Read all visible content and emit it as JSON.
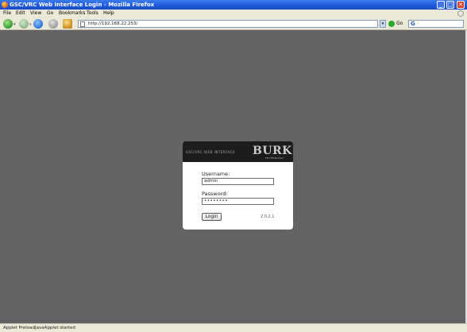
{
  "window": {
    "title": "GSC/VRC Web Interface Login - Mozilla Firefox",
    "controls": {
      "minimize": "_",
      "maximize": "□",
      "close": "✕"
    }
  },
  "menu": [
    "File",
    "Edit",
    "View",
    "Go",
    "Bookmarks",
    "Tools",
    "Help"
  ],
  "toolbar": {
    "url": "http://192.168.22.253/",
    "go_label": "Go",
    "search_engine_icon": "G",
    "icons": [
      "back-icon",
      "forward-icon",
      "reload-icon",
      "stop-icon",
      "home-icon"
    ]
  },
  "login": {
    "app_title": "GSC/VRC WEB INTERFACE",
    "logo": "BURK",
    "logo_sub": "TECHNOLOGY",
    "username_label": "Username:",
    "username_value": "admin",
    "password_label": "Password:",
    "password_value": "••••••••",
    "login_button": "Login",
    "version": "2.0.2.1"
  },
  "status": {
    "text": "Applet PreloadJavaApplet started"
  },
  "colors": {
    "content_bg": "#636363",
    "card_header_bg": "#1c1c1c",
    "titlebar": "#1f57d8"
  }
}
